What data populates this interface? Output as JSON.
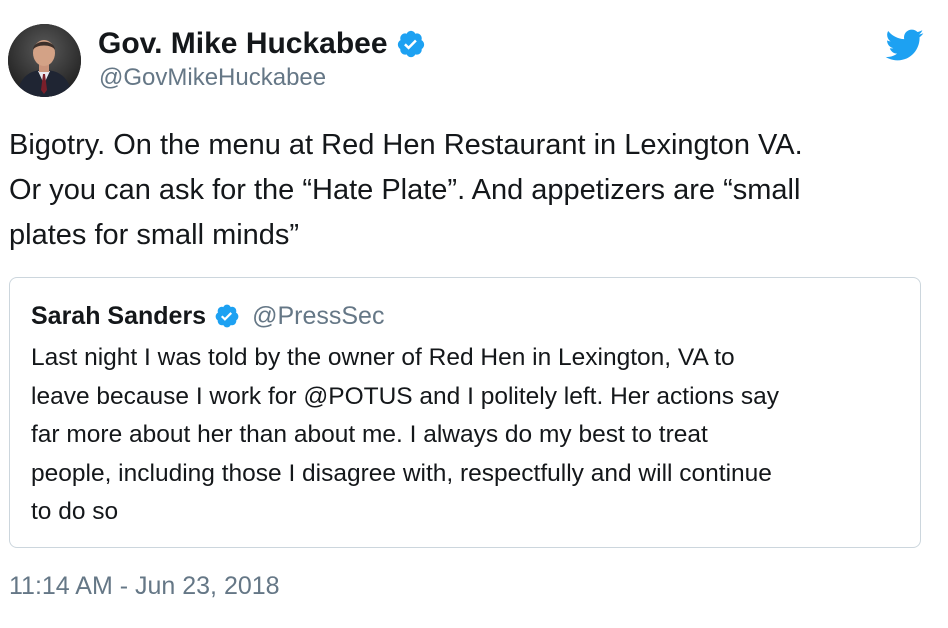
{
  "author": {
    "display_name": "Gov. Mike Huckabee",
    "handle": "@GovMikeHuckabee",
    "verified": true,
    "avatar_icon": "profile-photo"
  },
  "brand": {
    "icon": "twitter-bird-icon",
    "color": "#1da1f2"
  },
  "tweet": {
    "text_lines": [
      "Bigotry. On the menu at Red Hen Restaurant in Lexington VA.",
      "Or you can ask for the “Hate Plate”.  And appetizers are “small",
      "plates for small minds”"
    ],
    "timestamp": "11:14 AM - Jun 23, 2018"
  },
  "quoted_tweet": {
    "display_name": "Sarah Sanders",
    "handle": "@PressSec",
    "verified": true,
    "text_lines": [
      "Last night I was told by the owner of Red Hen in Lexington, VA to",
      "leave because I work for @POTUS and I politely left. Her actions say",
      "far more about her than about me. I always do my best to treat",
      "people, including those I disagree with, respectfully and will continue",
      "to do so"
    ]
  },
  "colors": {
    "text_primary": "#14171a",
    "text_secondary": "#657786",
    "verified_blue": "#1da1f2",
    "card_border": "#ccd6dd"
  }
}
